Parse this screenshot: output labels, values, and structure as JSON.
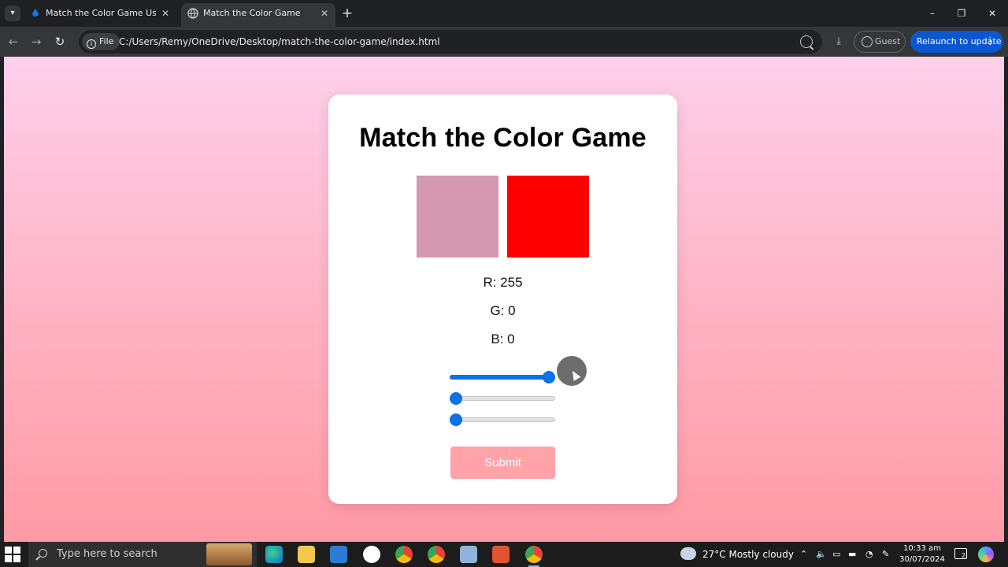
{
  "browser": {
    "tabs": [
      {
        "label": "Match the Color Game Using H",
        "active": false
      },
      {
        "label": "Match the Color Game",
        "active": true
      }
    ],
    "new_tab_symbol": "+",
    "address": {
      "scheme_chip": "File",
      "url": "C:/Users/Remy/OneDrive/Desktop/match-the-color-game/index.html"
    },
    "profile_label": "Guest",
    "relaunch_label": "Relaunch to update",
    "icons": {
      "back": "arrow-left-icon",
      "forward": "arrow-right-icon",
      "reload": "reload-icon",
      "zoom": "zoom-icon",
      "download": "download-icon"
    }
  },
  "game": {
    "title": "Match the Color Game",
    "target_color": "#d498b0",
    "player_color": "#ff0000",
    "values": {
      "r_text": "R: 255",
      "g_text": "G: 0",
      "b_text": "B: 0"
    },
    "sliders": {
      "r": 255,
      "g": 0,
      "b": 0,
      "max": 255
    },
    "submit_label": "Submit"
  },
  "taskbar": {
    "search_placeholder": "Type here to search",
    "weather": "27°C  Mostly cloudy",
    "time": "10:33 am",
    "date": "30/07/2024",
    "notification_count": "2"
  },
  "colors": {
    "accent_blue": "#0b72e7",
    "submit_bg": "#ffa3a9",
    "relaunch_blue": "#0b57d0"
  }
}
